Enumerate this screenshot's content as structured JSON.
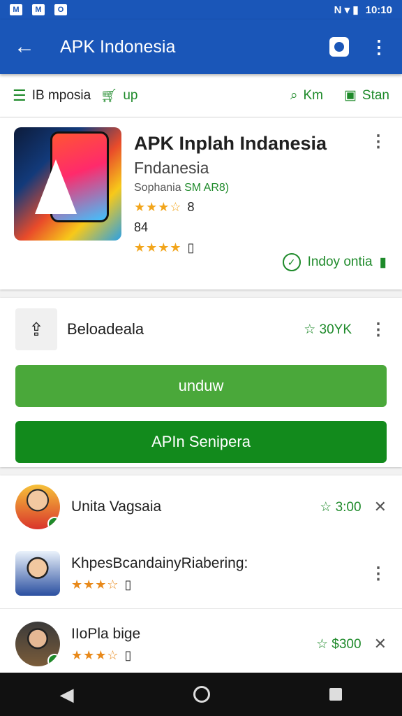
{
  "status": {
    "time": "10:10",
    "left_icons": [
      "M",
      "M",
      "O"
    ],
    "right_text": "N ▾ ▮"
  },
  "appbar": {
    "title": "APK Indonesia",
    "back_icon": "back-arrow-icon",
    "more_icon": "more-vert-icon"
  },
  "filters": {
    "left_label": "IB mposia",
    "left_action": "up",
    "right_label1": "Km",
    "right_label2": "Stan"
  },
  "app": {
    "name": "APK Inplah Indanesia",
    "subtitle": "Fndanesia",
    "developer_prefix": "Sophania",
    "developer_tag": "SM AR8)",
    "stat1": "8",
    "stat2": "84",
    "badge": "Indoy ontia"
  },
  "download": {
    "label": "Beloadeala",
    "rating": "30YK",
    "button_primary": "unduw",
    "button_secondary": "APIn Senipera"
  },
  "reviews": [
    {
      "name": "Unita Vagsaia",
      "rating": "3:00"
    },
    {
      "name": "KhpesBcandainyRiabering:",
      "rating": ""
    },
    {
      "name": "IIoPla bige",
      "rating": "$300"
    }
  ],
  "colors": {
    "primary": "#1a56b8",
    "accent": "#1e8a2a",
    "button_light": "#4aa83a",
    "button_dark": "#128a1c"
  }
}
